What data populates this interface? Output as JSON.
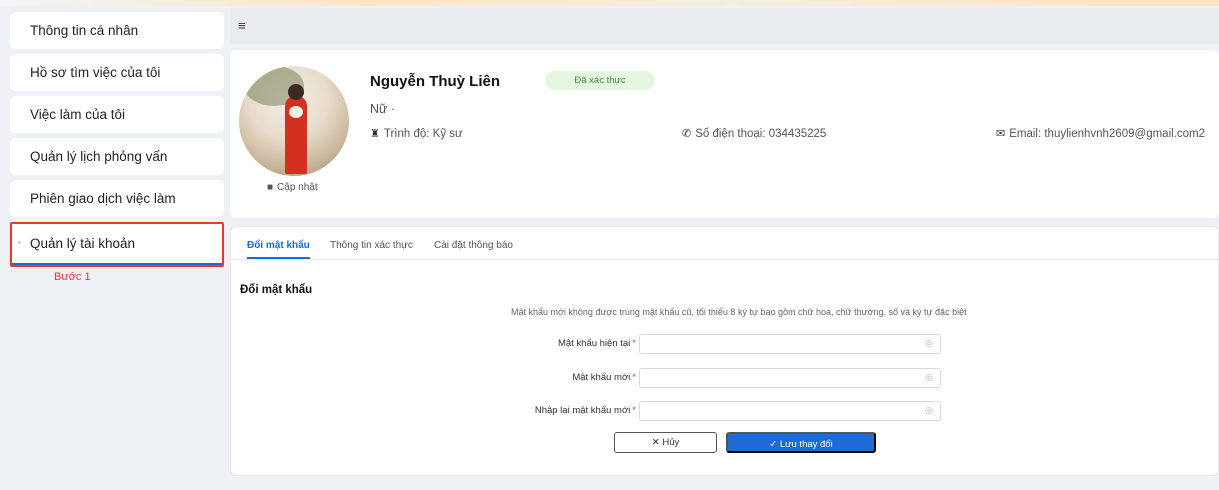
{
  "sidebar": {
    "items": [
      {
        "label": "Thông tin cá nhân"
      },
      {
        "label": "Hồ sơ tìm việc của tôi"
      },
      {
        "label": "Việc làm của tôi"
      },
      {
        "label": "Quản lý lịch phỏng vấn"
      },
      {
        "label": "Phiên giao dịch việc làm"
      },
      {
        "label": "Quản lý tài khoản"
      }
    ],
    "step_annotation": "Bước 1",
    "active_index": 5
  },
  "header": {
    "menu_icon": "hamburger-icon",
    "menu_glyph": "≡"
  },
  "profile": {
    "name": "Nguyễn Thuỳ Liên",
    "verified_badge": "Đã xác thực",
    "gender": "Nữ ·",
    "level": "Trình độ: Kỹ sư",
    "phone": "Số điện thoại: 034435225",
    "email": "Email: thuylienhvnh2609@gmail.com2",
    "update_label": "Cập nhật",
    "icons": {
      "level": "graduation-icon",
      "phone": "phone-icon",
      "email": "envelope-icon",
      "camera": "camera-icon"
    }
  },
  "tabs": [
    {
      "label": "Đổi mật khẩu",
      "active": true
    },
    {
      "label": "Thông tin xác thực",
      "active": false
    },
    {
      "label": "Cài đặt thông báo",
      "active": false
    }
  ],
  "form": {
    "title": "Đổi mật khẩu",
    "hint": "Mật khẩu mới không được trùng mật khẩu cũ, tối thiểu 8 ký tự bao gồm chữ hoa, chữ thường, số và ký tự đặc biệt",
    "fields": [
      {
        "label": "Mật khẩu hiện tại",
        "value": ""
      },
      {
        "label": "Mật khẩu mới",
        "value": ""
      },
      {
        "label": "Nhập lại mật khẩu mới",
        "value": ""
      }
    ],
    "required_marker": "*",
    "cancel_label": "✕ Hủy",
    "save_label": "✓ Lưu thay đổi"
  },
  "colors": {
    "accent": "#1e6bd6",
    "highlight": "#e53935",
    "verified_bg": "#e6f7e1",
    "verified_text": "#3f8f2f"
  }
}
